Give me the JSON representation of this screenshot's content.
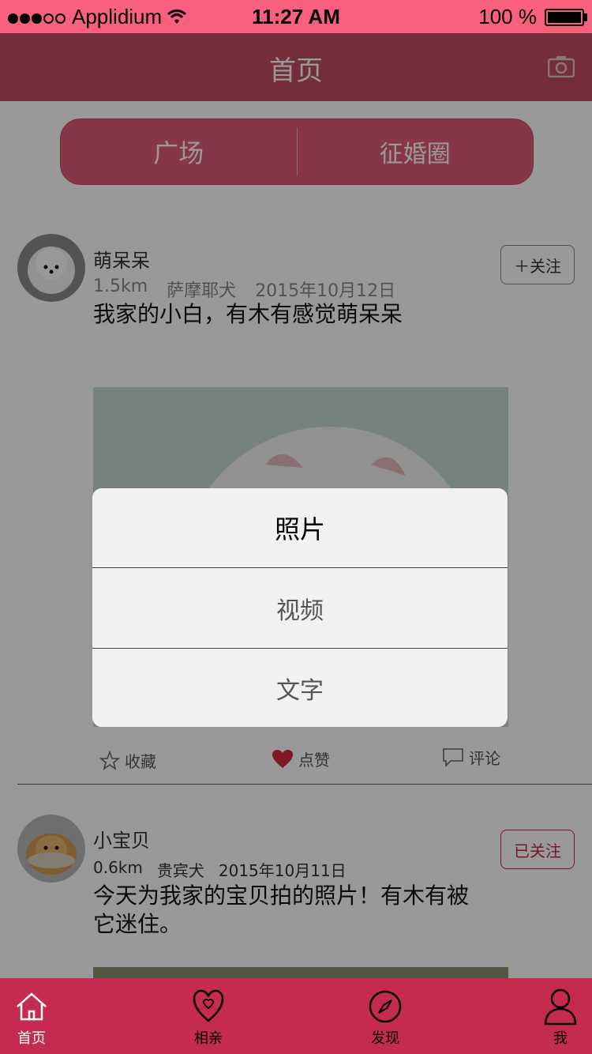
{
  "status_bar": {
    "carrier": "Applidium",
    "time": "11:27 AM",
    "battery": "100 %"
  },
  "nav": {
    "title": "首页",
    "camera_icon": "camera-icon"
  },
  "segment": {
    "tabs": [
      {
        "label": "广场"
      },
      {
        "label": "征婚圈"
      }
    ]
  },
  "posts": [
    {
      "username": "萌呆呆",
      "distance": "1.5km",
      "breed": "萨摩耶犬",
      "date": "2015年10月12日",
      "text": "我家的小白，有木有感觉萌呆呆",
      "follow_label": "＋关注",
      "actions": {
        "collect": "收藏",
        "like": "点赞",
        "comment": "评论"
      }
    },
    {
      "username": "小宝贝",
      "distance": "0.6km",
      "breed": "贵宾犬",
      "date": "2015年10月11日",
      "text_line1": "今天为我家的宝贝拍的照片！有木有被",
      "text_line2": "它迷住。",
      "follow_label": "已关注"
    }
  ],
  "action_sheet": {
    "options": [
      {
        "label": "照片"
      },
      {
        "label": "视频"
      },
      {
        "label": "文字"
      }
    ]
  },
  "tabbar": {
    "items": [
      {
        "label": "首页",
        "icon": "home-icon"
      },
      {
        "label": "相亲",
        "icon": "heart-icon"
      },
      {
        "label": "发现",
        "icon": "compass-icon"
      },
      {
        "label": "我",
        "icon": "person-icon"
      }
    ]
  },
  "colors": {
    "status_bar": "#f8607e",
    "nav_bar": "#c14b61",
    "tab_bar": "#c42b4f",
    "accent": "#c8283f"
  }
}
